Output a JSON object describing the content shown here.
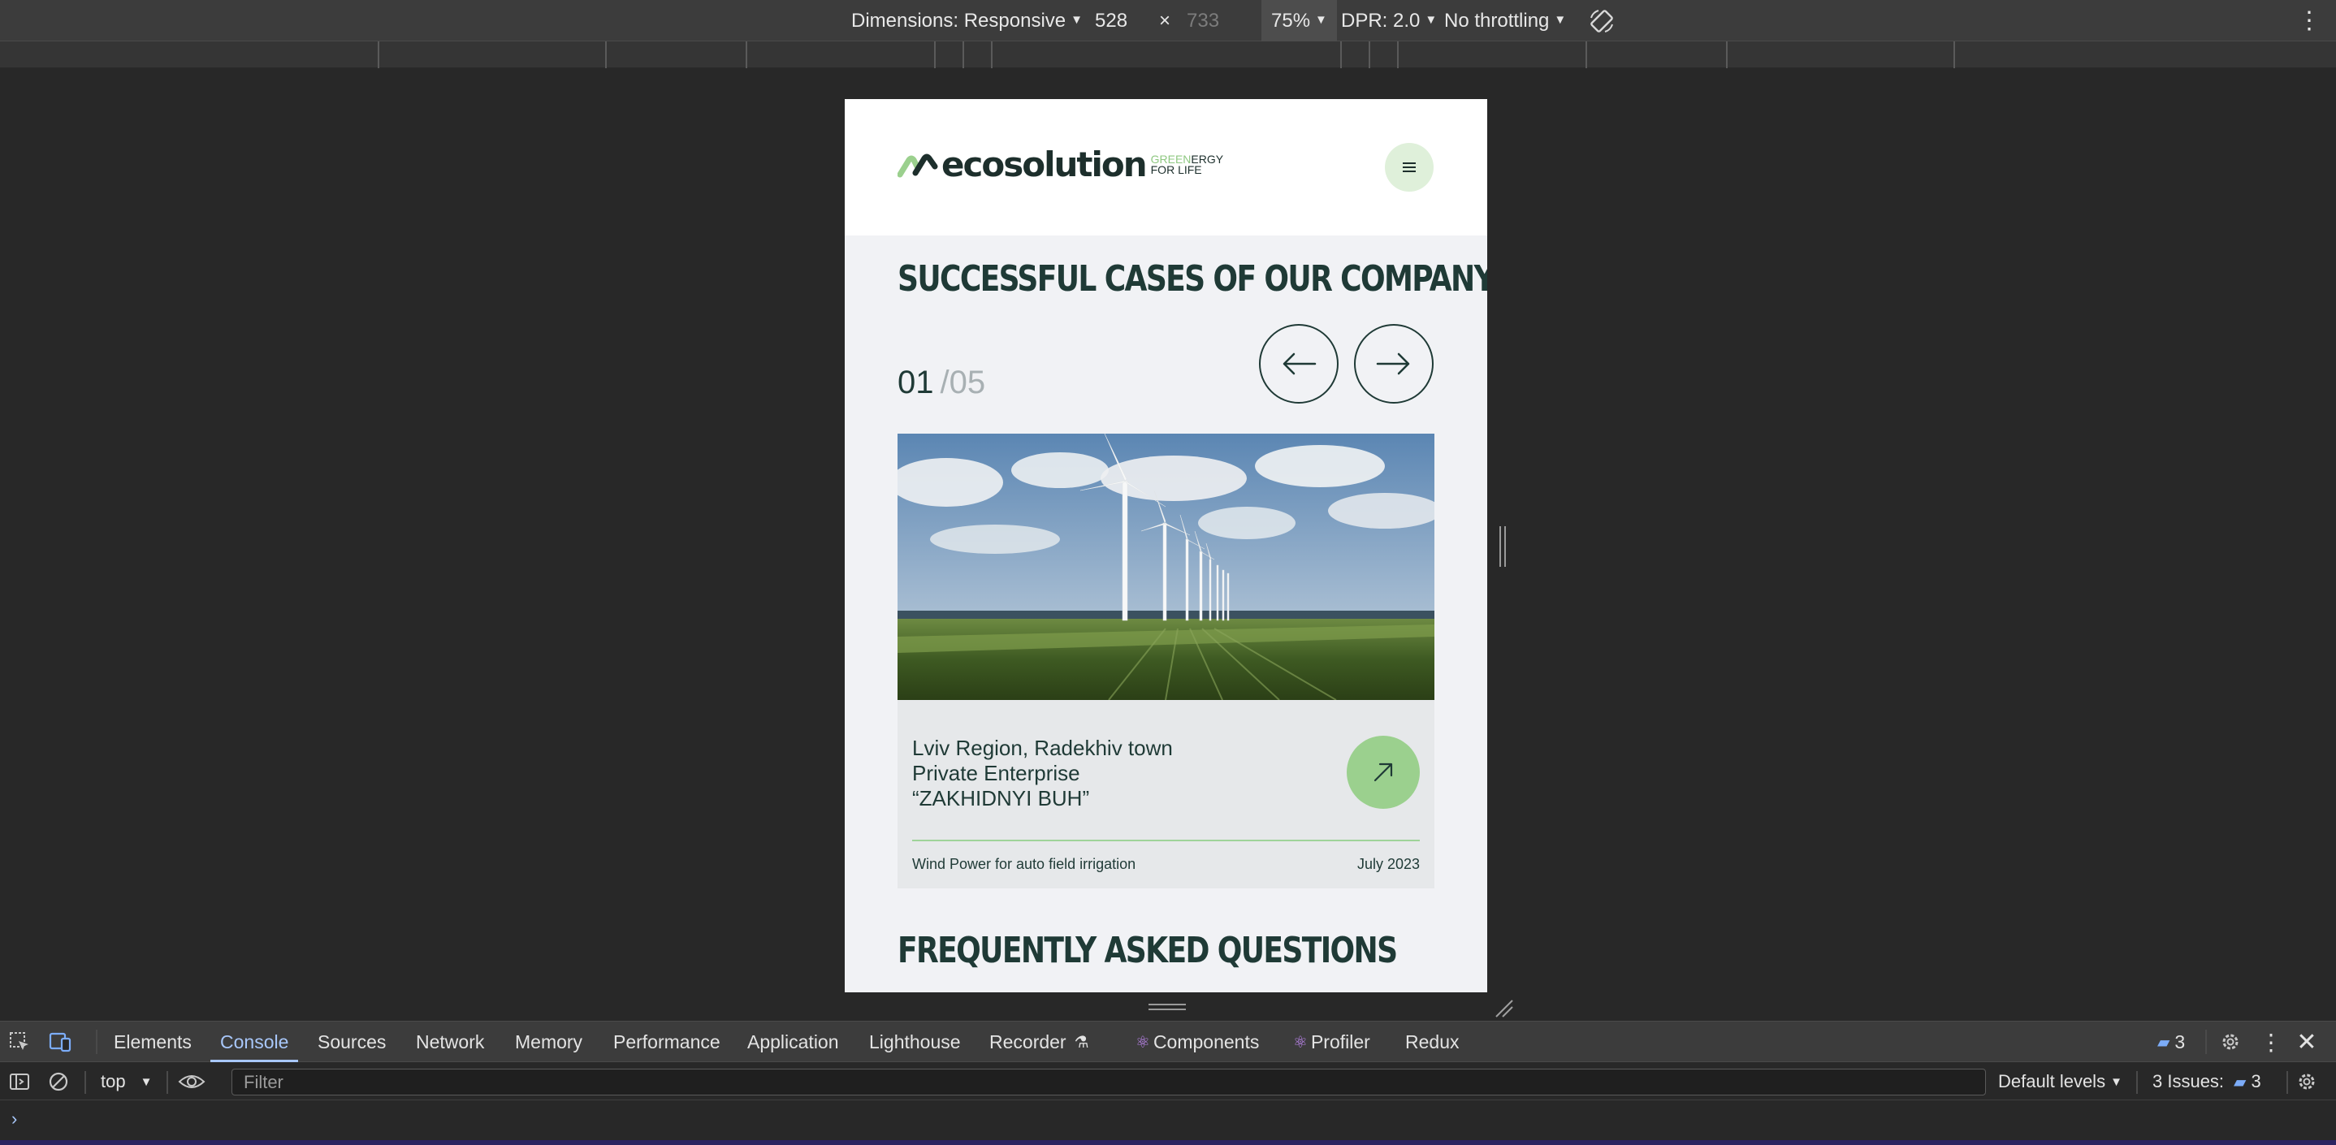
{
  "device_toolbar": {
    "dimensions_label": "Dimensions: Responsive",
    "width": "528",
    "times": "×",
    "height_placeholder": "733",
    "zoom": "75%",
    "dpr": "DPR: 2.0",
    "throttling": "No throttling"
  },
  "site": {
    "logo_word": "ecosolution",
    "logo_tag_green": "GREEN",
    "logo_tag_dark": "ERGY",
    "logo_tag_line2": "FOR LIFE",
    "cases_title": "SUCCESSFUL CASES OF OUR COMPANY",
    "counter_current": "01",
    "counter_slash": "/",
    "counter_total": "05",
    "case": {
      "title": "Lviv Region, Radekhiv town Private Enterprise “ZAKHIDNYI BUH”",
      "meta": "Wind Power for auto field irrigation",
      "date": "July 2023"
    },
    "faq_title": "FREQUENTLY ASKED QUESTIONS"
  },
  "devtools": {
    "tabs": [
      "Elements",
      "Console",
      "Sources",
      "Network",
      "Memory",
      "Performance",
      "Application",
      "Lighthouse",
      "Recorder",
      "Components",
      "Profiler",
      "Redux"
    ],
    "issues_badge": "3",
    "context": "top",
    "filter_placeholder": "Filter",
    "levels": "Default levels",
    "issues_label": "3 Issues:",
    "issues_count": "3",
    "prompt": "›"
  }
}
